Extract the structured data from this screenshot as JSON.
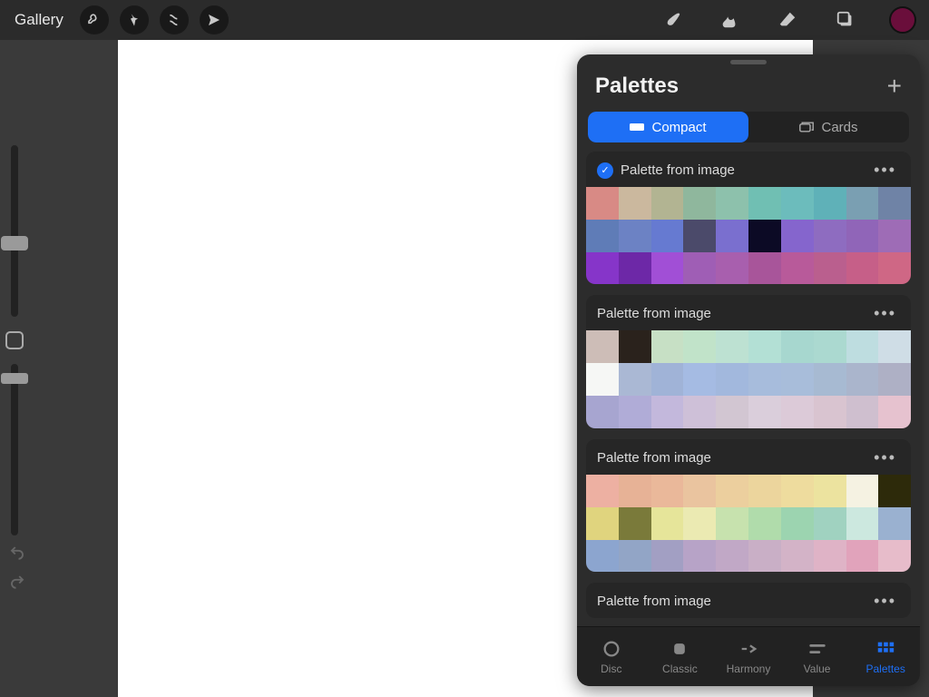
{
  "topbar": {
    "gallery_label": "Gallery",
    "current_color": "#6a0e3b"
  },
  "panel": {
    "title": "Palettes",
    "segments": {
      "compact": "Compact",
      "cards": "Cards",
      "active": "compact"
    },
    "palettes": [
      {
        "name": "Palette from image",
        "selected": true,
        "rows": [
          [
            "#d88a85",
            "#cbb89e",
            "#b2b492",
            "#8fb79d",
            "#8dc1ac",
            "#70bfb3",
            "#6cbcbc",
            "#5fb1b8",
            "#7a9fb2",
            "#6f83a6"
          ],
          [
            "#5f7cb7",
            "#6c82c4",
            "#667ad1",
            "#4b4a6a",
            "#7a6fcf",
            "#0c0a25",
            "#8565cd",
            "#8e6cc0",
            "#9065b8",
            "#9e6cb6"
          ],
          [
            "#8635c9",
            "#6d28a7",
            "#a14fd6",
            "#9f5eb5",
            "#a85fae",
            "#a8559a",
            "#b85a9a",
            "#ba5f8e",
            "#c65f88",
            "#cf6785"
          ]
        ]
      },
      {
        "name": "Palette from image",
        "selected": false,
        "rows": [
          [
            "#cdbdb7",
            "#2a221c",
            "#c7e0c5",
            "#c1e3c9",
            "#bde1d2",
            "#b3e0d5",
            "#a7d7cf",
            "#abd9d0",
            "#bedde0",
            "#cfdde6"
          ],
          [
            "#f6f7f5",
            "#aab8d4",
            "#a0b3d7",
            "#a5bbe3",
            "#a2b8dd",
            "#a7bcdc",
            "#a8bdda",
            "#a7bad2",
            "#aab5cc",
            "#aeb0c5"
          ],
          [
            "#a7a5d0",
            "#b0acd7",
            "#c3b8dc",
            "#cec0d8",
            "#d2c6d2",
            "#dacedb",
            "#dccad8",
            "#d9c4d0",
            "#cfbfcf",
            "#e6c2cf"
          ]
        ]
      },
      {
        "name": "Palette from image",
        "selected": false,
        "rows": [
          [
            "#edb0a2",
            "#e7b296",
            "#eab89a",
            "#eac49f",
            "#eccf9e",
            "#ecd59d",
            "#eedc9e",
            "#ece39f",
            "#f5f2e2",
            "#2d2a0a"
          ],
          [
            "#e0d47e",
            "#7a7a3a",
            "#e6e59a",
            "#ebeab2",
            "#c7e2ae",
            "#b0dcab",
            "#9cd4b0",
            "#a0d2c0",
            "#cce8df",
            "#9ab1d0"
          ],
          [
            "#8ca5cf",
            "#92a5c6",
            "#a29fc3",
            "#b7a3c7",
            "#c1a8c6",
            "#c9afc6",
            "#d3b3c7",
            "#dfb3c6",
            "#e1a3bb",
            "#e7bcca"
          ]
        ]
      },
      {
        "name": "Palette from image",
        "selected": false,
        "rows": []
      }
    ],
    "tabs": [
      {
        "key": "disc",
        "label": "Disc"
      },
      {
        "key": "classic",
        "label": "Classic"
      },
      {
        "key": "harmony",
        "label": "Harmony"
      },
      {
        "key": "value",
        "label": "Value"
      },
      {
        "key": "palettes",
        "label": "Palettes"
      }
    ],
    "active_tab": "palettes"
  }
}
